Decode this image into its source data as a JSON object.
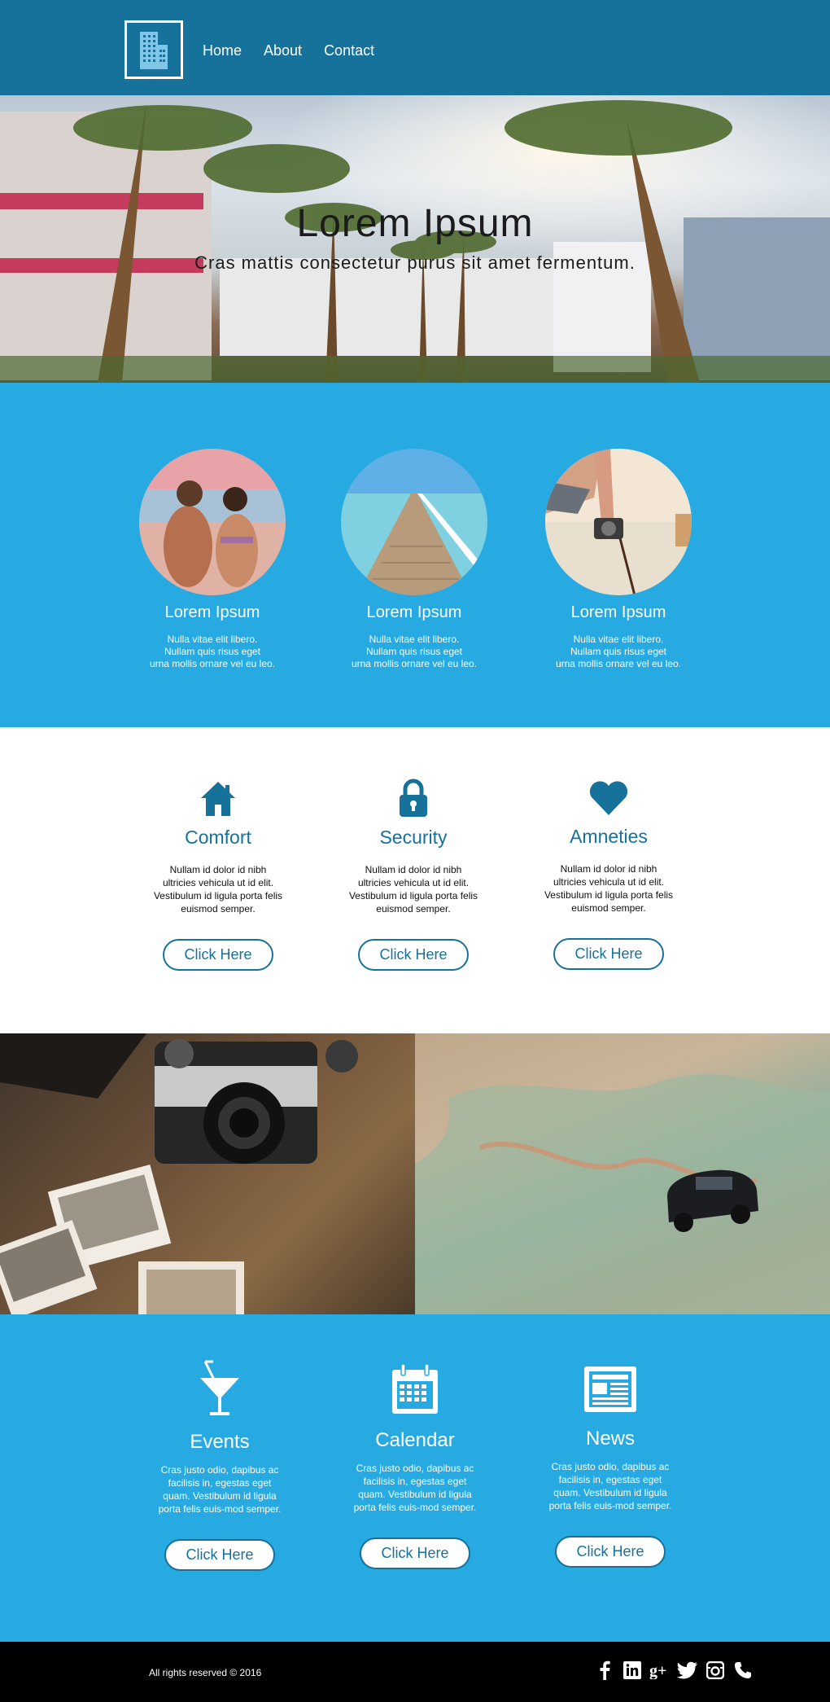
{
  "nav": {
    "logo_icon": "building-icon",
    "items": [
      {
        "label": "Home"
      },
      {
        "label": "About"
      },
      {
        "label": "Contact"
      }
    ]
  },
  "hero": {
    "title": "Lorem Ipsum",
    "subtitle": "Cras mattis consectetur purus sit amet fermentum."
  },
  "features": [
    {
      "title": "Lorem Ipsum",
      "text": "Nulla vitae elit libero.\nNullam quis risus eget\nurna mollis ornare vel eu leo."
    },
    {
      "title": "Lorem Ipsum",
      "text": "Nulla vitae elit libero.\nNullam quis risus eget\nurna mollis ornare vel eu leo."
    },
    {
      "title": "Lorem Ipsum",
      "text": "Nulla vitae elit libero.\nNullam quis risus eget\nurna mollis ornare vel eu leo."
    }
  ],
  "amenities": [
    {
      "icon": "home-icon",
      "title": "Comfort",
      "text": "Nullam id dolor id nibh ultricies vehicula ut id elit. Vestibulum id ligula porta felis euismod semper.",
      "button": "Click Here"
    },
    {
      "icon": "lock-icon",
      "title": "Security",
      "text": "Nullam id dolor id nibh ultricies vehicula ut id elit. Vestibulum id ligula porta felis euismod semper.",
      "button": "Click Here"
    },
    {
      "icon": "heart-icon",
      "title": "Amneties",
      "text": "Nullam id dolor id nibh ultricies vehicula ut id elit. Vestibulum id ligula porta felis euismod semper.",
      "button": "Click Here"
    }
  ],
  "services": [
    {
      "icon": "cocktail-icon",
      "title": "Events",
      "text": "Cras justo odio, dapibus ac facilisis in, egestas eget quam. Vestibulum id ligula porta felis euis-mod semper.",
      "button": "Click Here"
    },
    {
      "icon": "calendar-icon",
      "title": "Calendar",
      "text": "Cras justo odio, dapibus ac facilisis in, egestas eget quam. Vestibulum id ligula porta felis euis-mod semper.",
      "button": "Click Here"
    },
    {
      "icon": "newspaper-icon",
      "title": "News",
      "text": "Cras justo odio, dapibus ac facilisis in, egestas eget quam. Vestibulum id ligula porta felis euis-mod semper.",
      "button": "Click Here"
    }
  ],
  "footer": {
    "copyright": "All rights reserved © 2016",
    "social_icons": [
      "facebook-icon",
      "linkedin-icon",
      "google-plus-icon",
      "twitter-icon",
      "instagram-icon",
      "phone-icon"
    ]
  },
  "colors": {
    "header_bg": "#16719b",
    "section_blue": "#27a9e1",
    "accent_dark_blue": "#16719b",
    "footer_bg": "#000000"
  }
}
